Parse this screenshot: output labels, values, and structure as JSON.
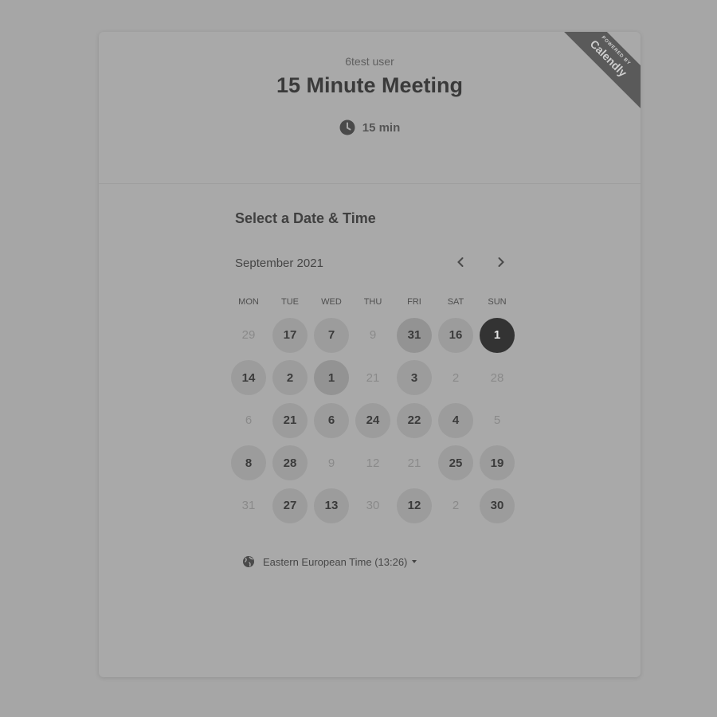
{
  "event": {
    "host": "6test user",
    "title": "15 Minute Meeting",
    "duration": "15 min",
    "duration_icon": "clock-icon"
  },
  "ribbon": {
    "powered_by": "POWERED BY",
    "brand": "Calendly"
  },
  "scheduler": {
    "section_title": "Select a Date & Time",
    "month_label": "September 2021",
    "weekdays": [
      "MON",
      "TUE",
      "WED",
      "THU",
      "FRI",
      "SAT",
      "SUN"
    ],
    "weeks": [
      [
        {
          "label": "29",
          "state": "unavailable"
        },
        {
          "label": "17",
          "state": "available"
        },
        {
          "label": "7",
          "state": "available"
        },
        {
          "label": "9",
          "state": "unavailable"
        },
        {
          "label": "31",
          "state": "available-dark"
        },
        {
          "label": "16",
          "state": "available"
        },
        {
          "label": "1",
          "state": "selected"
        }
      ],
      [
        {
          "label": "14",
          "state": "available"
        },
        {
          "label": "2",
          "state": "available"
        },
        {
          "label": "1",
          "state": "available-dark"
        },
        {
          "label": "21",
          "state": "unavailable"
        },
        {
          "label": "3",
          "state": "available"
        },
        {
          "label": "2",
          "state": "unavailable"
        },
        {
          "label": "28",
          "state": "unavailable"
        }
      ],
      [
        {
          "label": "6",
          "state": "unavailable"
        },
        {
          "label": "21",
          "state": "available"
        },
        {
          "label": "6",
          "state": "available"
        },
        {
          "label": "24",
          "state": "available"
        },
        {
          "label": "22",
          "state": "available"
        },
        {
          "label": "4",
          "state": "available"
        },
        {
          "label": "5",
          "state": "unavailable"
        }
      ],
      [
        {
          "label": "8",
          "state": "available"
        },
        {
          "label": "28",
          "state": "available"
        },
        {
          "label": "9",
          "state": "unavailable"
        },
        {
          "label": "12",
          "state": "unavailable"
        },
        {
          "label": "21",
          "state": "unavailable"
        },
        {
          "label": "25",
          "state": "available"
        },
        {
          "label": "19",
          "state": "available"
        }
      ],
      [
        {
          "label": "31",
          "state": "unavailable"
        },
        {
          "label": "27",
          "state": "available"
        },
        {
          "label": "13",
          "state": "available"
        },
        {
          "label": "30",
          "state": "unavailable"
        },
        {
          "label": "12",
          "state": "available"
        },
        {
          "label": "2",
          "state": "unavailable"
        },
        {
          "label": "30",
          "state": "available"
        }
      ]
    ],
    "timezone": "Eastern European Time (13:26)",
    "timezone_icon": "globe-icon"
  }
}
